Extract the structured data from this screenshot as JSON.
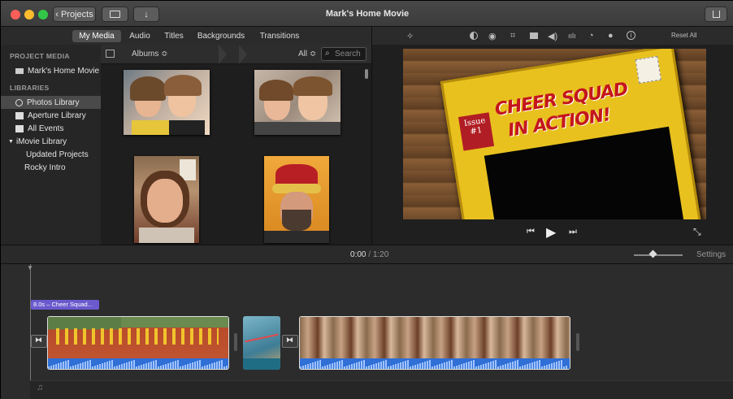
{
  "window": {
    "title": "Mark's Home Movie"
  },
  "toolbar": {
    "back_label": "Projects"
  },
  "tabs": [
    {
      "label": "My Media",
      "active": true
    },
    {
      "label": "Audio"
    },
    {
      "label": "Titles"
    },
    {
      "label": "Backgrounds"
    },
    {
      "label": "Transitions"
    }
  ],
  "sidebar": {
    "project_header": "PROJECT MEDIA",
    "project_item": "Mark's Home Movie",
    "libraries_header": "LIBRARIES",
    "items": [
      {
        "label": "Photos Library",
        "selected": true
      },
      {
        "label": "Aperture Library"
      },
      {
        "label": "All Events"
      },
      {
        "label": "iMovie Library"
      },
      {
        "label": "Updated Projects"
      },
      {
        "label": "Rocky Intro"
      }
    ]
  },
  "browser": {
    "albums_label": "Albums ≎",
    "filter_label": "All ≎",
    "search_placeholder": "Search"
  },
  "viewer_tools": {
    "reset_label": "Reset All"
  },
  "viewer": {
    "comic_issue": "Issue",
    "comic_number": "#1",
    "comic_title_1": "CHEER SQUAD",
    "comic_title_2": "IN ACTION!"
  },
  "timeline_bar": {
    "current_time": "0:00",
    "separator": "/",
    "total_time": "1:20",
    "settings_label": "Settings"
  },
  "timeline": {
    "title_clip_label": "8.0s – Cheer Squad..."
  },
  "colors": {
    "accent": "#6a5acd",
    "audio_blue": "#2f6fd6",
    "close": "#fc5f57",
    "minimize": "#fdbc2e",
    "zoom": "#33c748"
  }
}
